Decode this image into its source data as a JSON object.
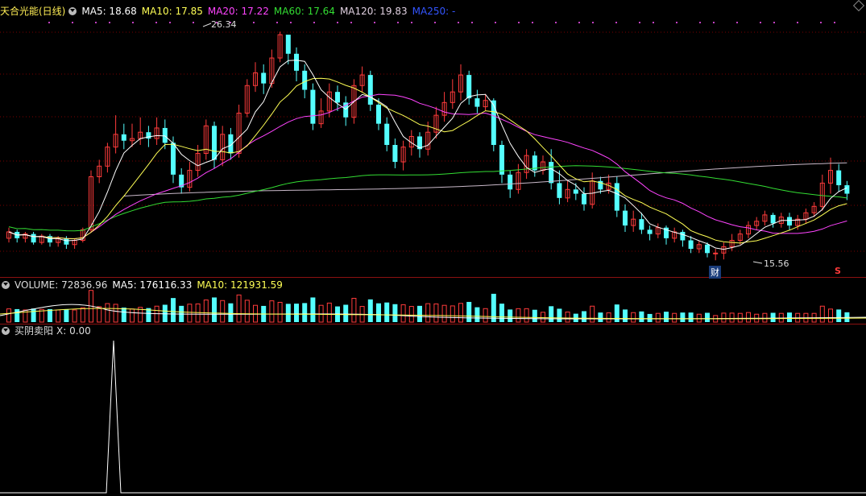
{
  "main_header": {
    "title": "天合光能(日线)",
    "ma5": "MA5: 18.68",
    "ma10": "MA10: 17.85",
    "ma20": "MA20: 17.22",
    "ma60": "MA60: 17.64",
    "ma120": "MA120: 19.83",
    "ma250": "MA250: -"
  },
  "volume_header": {
    "label": "VOLUME: 72836.96",
    "ma5": "MA5: 176116.33",
    "ma10": "MA10: 121931.59"
  },
  "indicator_header": {
    "label": "买阴卖阳",
    "value": "X: 0.00"
  },
  "annotations": {
    "high": "26.34",
    "low": "15.56",
    "fin": "财",
    "s": "S"
  },
  "colors": {
    "up": "#ff3b3b",
    "down": "#54ffff",
    "ma5": "#ffffff",
    "ma10": "#ffff55",
    "ma20": "#ff44ff",
    "ma60": "#33dd33",
    "ma120": "#c8b8c8",
    "ma250": "#3355ff",
    "grid": "#7a0000"
  },
  "chart_data": {
    "type": "candlestick",
    "price_range": [
      15.0,
      27.0
    ],
    "candles": [
      [
        16.6,
        16.9,
        17.1,
        16.4
      ],
      [
        16.9,
        16.6,
        17.0,
        16.4
      ],
      [
        16.6,
        16.8,
        16.9,
        16.4
      ],
      [
        16.8,
        16.4,
        16.9,
        16.3
      ],
      [
        16.4,
        16.7,
        16.8,
        16.3
      ],
      [
        16.7,
        16.4,
        16.8,
        16.2
      ],
      [
        16.4,
        16.6,
        16.7,
        16.2
      ],
      [
        16.6,
        16.3,
        16.7,
        16.1
      ],
      [
        16.3,
        16.5,
        16.6,
        16.1
      ],
      [
        16.5,
        17.0,
        17.1,
        16.4
      ],
      [
        17.0,
        19.5,
        19.8,
        16.9
      ],
      [
        19.5,
        20.0,
        20.3,
        19.2
      ],
      [
        20.0,
        20.9,
        21.1,
        19.7
      ],
      [
        20.9,
        21.5,
        22.4,
        20.6
      ],
      [
        21.5,
        21.2,
        22.0,
        20.8
      ],
      [
        21.2,
        21.3,
        22.0,
        20.9
      ],
      [
        21.3,
        21.6,
        22.3,
        21.0
      ],
      [
        21.6,
        21.3,
        21.9,
        20.9
      ],
      [
        21.3,
        21.8,
        22.3,
        21.0
      ],
      [
        21.8,
        21.1,
        22.2,
        20.8
      ],
      [
        21.1,
        19.6,
        21.4,
        19.2
      ],
      [
        19.6,
        19.0,
        19.9,
        18.7
      ],
      [
        19.0,
        19.8,
        20.2,
        18.8
      ],
      [
        19.8,
        20.6,
        21.0,
        19.5
      ],
      [
        20.6,
        21.9,
        22.2,
        20.3
      ],
      [
        21.9,
        20.3,
        22.1,
        19.9
      ],
      [
        20.3,
        21.5,
        21.9,
        20.0
      ],
      [
        21.5,
        20.6,
        21.8,
        20.3
      ],
      [
        20.6,
        22.5,
        22.9,
        20.4
      ],
      [
        22.5,
        23.8,
        24.1,
        22.3
      ],
      [
        23.8,
        24.4,
        24.9,
        23.5
      ],
      [
        24.4,
        23.9,
        24.8,
        23.4
      ],
      [
        23.9,
        25.1,
        25.5,
        23.7
      ],
      [
        25.1,
        26.2,
        26.34,
        24.9
      ],
      [
        26.2,
        25.3,
        26.1,
        24.8
      ],
      [
        25.3,
        24.5,
        25.6,
        24.0
      ],
      [
        24.5,
        23.6,
        24.8,
        23.2
      ],
      [
        23.6,
        22.0,
        23.9,
        21.7
      ],
      [
        22.0,
        22.6,
        23.2,
        21.8
      ],
      [
        22.6,
        23.5,
        23.9,
        22.3
      ],
      [
        23.5,
        23.0,
        23.8,
        22.6
      ],
      [
        23.0,
        22.3,
        23.3,
        21.9
      ],
      [
        22.3,
        23.8,
        24.1,
        22.0
      ],
      [
        23.8,
        24.3,
        24.7,
        23.5
      ],
      [
        24.3,
        22.9,
        24.5,
        22.6
      ],
      [
        22.9,
        22.0,
        23.2,
        21.7
      ],
      [
        22.0,
        21.0,
        22.3,
        20.7
      ],
      [
        21.0,
        20.2,
        21.3,
        19.9
      ],
      [
        20.2,
        20.9,
        21.2,
        19.8
      ],
      [
        20.9,
        21.4,
        21.7,
        20.5
      ],
      [
        21.4,
        20.8,
        21.6,
        20.4
      ],
      [
        20.8,
        21.6,
        22.1,
        20.5
      ],
      [
        21.6,
        22.4,
        22.8,
        21.3
      ],
      [
        22.4,
        23.0,
        23.5,
        22.1
      ],
      [
        23.0,
        23.5,
        24.1,
        22.7
      ],
      [
        23.5,
        24.3,
        24.8,
        23.1
      ],
      [
        24.3,
        23.2,
        24.5,
        22.9
      ],
      [
        23.2,
        22.8,
        23.6,
        22.5
      ],
      [
        22.8,
        23.1,
        23.4,
        22.6
      ],
      [
        23.1,
        21.0,
        23.2,
        20.7
      ],
      [
        21.0,
        19.6,
        21.2,
        19.2
      ],
      [
        19.6,
        18.9,
        19.8,
        18.5
      ],
      [
        18.9,
        19.7,
        20.1,
        18.7
      ],
      [
        19.7,
        20.5,
        20.8,
        19.4
      ],
      [
        20.5,
        19.8,
        20.7,
        19.5
      ],
      [
        19.8,
        20.2,
        20.5,
        19.6
      ],
      [
        20.2,
        19.2,
        20.8,
        18.9
      ],
      [
        19.2,
        18.5,
        19.8,
        18.2
      ],
      [
        18.5,
        18.9,
        19.3,
        18.3
      ],
      [
        18.9,
        18.7,
        19.2,
        18.4
      ],
      [
        18.7,
        18.2,
        19.0,
        17.9
      ],
      [
        18.2,
        19.3,
        19.7,
        18.0
      ],
      [
        19.3,
        18.9,
        19.5,
        18.7
      ],
      [
        18.9,
        19.2,
        19.6,
        18.7
      ],
      [
        19.2,
        17.9,
        19.5,
        17.6
      ],
      [
        17.9,
        17.2,
        18.2,
        16.9
      ],
      [
        17.2,
        17.5,
        17.9,
        16.9
      ],
      [
        17.5,
        17.0,
        17.8,
        16.8
      ],
      [
        17.0,
        16.8,
        17.2,
        16.5
      ],
      [
        16.8,
        17.1,
        17.3,
        16.6
      ],
      [
        17.1,
        16.6,
        17.2,
        16.3
      ],
      [
        16.6,
        16.9,
        17.1,
        16.4
      ],
      [
        16.9,
        16.5,
        17.0,
        16.2
      ],
      [
        16.5,
        16.1,
        16.7,
        15.9
      ],
      [
        16.1,
        16.3,
        16.5,
        15.9
      ],
      [
        16.3,
        15.9,
        16.4,
        15.7
      ],
      [
        15.9,
        15.9,
        16.1,
        15.56
      ],
      [
        15.9,
        16.2,
        16.4,
        15.6
      ],
      [
        16.2,
        16.5,
        16.8,
        16.0
      ],
      [
        16.5,
        16.8,
        17.0,
        16.3
      ],
      [
        16.8,
        17.2,
        17.4,
        16.6
      ],
      [
        17.2,
        17.4,
        17.6,
        17.0
      ],
      [
        17.4,
        17.7,
        17.9,
        17.2
      ],
      [
        17.7,
        17.3,
        17.8,
        17.1
      ],
      [
        17.3,
        17.6,
        17.8,
        17.1
      ],
      [
        17.6,
        17.2,
        17.8,
        17.0
      ],
      [
        17.2,
        17.5,
        17.7,
        17.0
      ],
      [
        17.5,
        17.8,
        18.0,
        17.3
      ],
      [
        17.8,
        18.1,
        18.3,
        17.6
      ],
      [
        18.1,
        19.2,
        19.6,
        17.9
      ],
      [
        19.2,
        19.8,
        20.4,
        18.7
      ],
      [
        19.8,
        19.1,
        20.1,
        18.8
      ],
      [
        19.1,
        18.7,
        19.3,
        18.4
      ]
    ],
    "volume_range": [
      0,
      500000
    ],
    "indicator_range": [
      0,
      1
    ]
  }
}
